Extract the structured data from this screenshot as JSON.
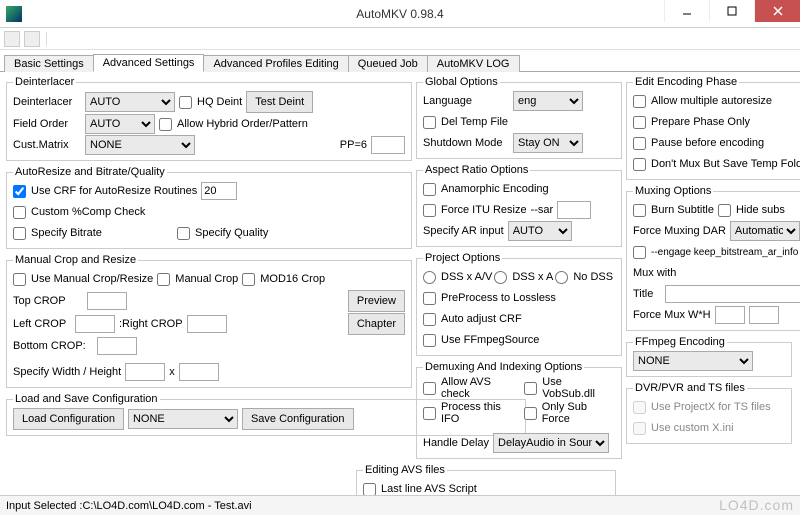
{
  "window": {
    "title": "AutoMKV 0.98.4"
  },
  "tabs": [
    "Basic Settings",
    "Advanced Settings",
    "Advanced Profiles Editing",
    "Queued Job",
    "AutoMKV LOG"
  ],
  "activeTab": 1,
  "deinterlacer": {
    "legend": "Deinterlacer",
    "label": "Deinterlacer",
    "value": "AUTO",
    "hqDeint": "HQ Deint",
    "testDeint": "Test Deint",
    "fieldOrderLabel": "Field Order",
    "fieldOrderValue": "AUTO",
    "allowHybrid": "Allow Hybrid Order/Pattern",
    "custMatrixLabel": "Cust.Matrix",
    "custMatrixValue": "NONE",
    "ppLabel": "PP=6"
  },
  "autoresize": {
    "legend": "AutoResize and Bitrate/Quality",
    "useCRF": "Use CRF for AutoResize Routines",
    "crfValue": "20",
    "customComp": "Custom %Comp Check",
    "specifyBitrate": "Specify Bitrate",
    "specifyQuality": "Specify Quality"
  },
  "manualcrop": {
    "legend": "Manual Crop and Resize",
    "useManual": "Use Manual Crop/Resize",
    "manualCrop": "Manual Crop",
    "mod16": "MOD16 Crop",
    "topCrop": "Top CROP",
    "leftCrop": "Left CROP",
    "rightCrop": ":Right CROP",
    "bottomCrop": "Bottom CROP:",
    "preview": "Preview",
    "chapter": "Chapter",
    "specifyWH": "Specify Width / Height",
    "x": "x"
  },
  "loadsave": {
    "legend": "Load and Save Configuration",
    "load": "Load Configuration",
    "save": "Save Configuration",
    "profile": "NONE"
  },
  "global": {
    "legend": "Global Options",
    "languageLabel": "Language",
    "languageValue": "eng",
    "delTemp": "Del Temp File",
    "shutdownLabel": "Shutdown Mode",
    "shutdownValue": "Stay ON"
  },
  "aspect": {
    "legend": "Aspect Ratio Options",
    "anamorphic": "Anamorphic Encoding",
    "forceITU": "Force ITU Resize",
    "sarLabel": "--sar",
    "specifyAR": "Specify AR input",
    "arValue": "AUTO"
  },
  "project": {
    "legend": "Project Options",
    "dssAV": "DSS x A/V",
    "dssA": "DSS x A",
    "noDSS": "No DSS",
    "preprocess": "PreProcess to Lossless",
    "autoCRF": "Auto adjust CRF",
    "ffmpegSrc": "Use FFmpegSource"
  },
  "demux": {
    "legend": "Demuxing And Indexing Options",
    "allowAVS": "Allow AVS check",
    "vobsub": "Use VobSub.dll",
    "processIFO": "Process this IFO",
    "onlySub": "Only Sub Force",
    "handleDelay": "Handle Delay",
    "delayValue": "DelayAudio in Sound"
  },
  "editavs": {
    "legend": "Editing AVS files",
    "lastline": "Last line AVS Script"
  },
  "editphase": {
    "legend": "Edit Encoding Phase",
    "allowMultiple": "Allow multiple autoresize",
    "prepareOnly": "Prepare Phase Only",
    "pauseBefore": "Pause before encoding",
    "dontMux": "Don't Mux But Save Temp Folder"
  },
  "muxing": {
    "legend": "Muxing Options",
    "burnSub": "Burn Subtitle",
    "hideSubs": "Hide subs",
    "forceDAR": "Force Muxing DAR",
    "darValue": "Automatic",
    "engage": "--engage keep_bitstream_ar_info",
    "muxWith": "Mux with",
    "titleLabel": "Title",
    "forceMux": "Force Mux W*H"
  },
  "ffmpeg": {
    "legend": "FFmpeg Encoding",
    "value": "NONE"
  },
  "dvr": {
    "legend": "DVR/PVR and TS files",
    "projectX": "Use ProjectX for TS files",
    "customX": "Use custom X.ini"
  },
  "status": "Input Selected :C:\\LO4D.com\\LO4D.com - Test.avi",
  "watermark": "LO4D.com"
}
